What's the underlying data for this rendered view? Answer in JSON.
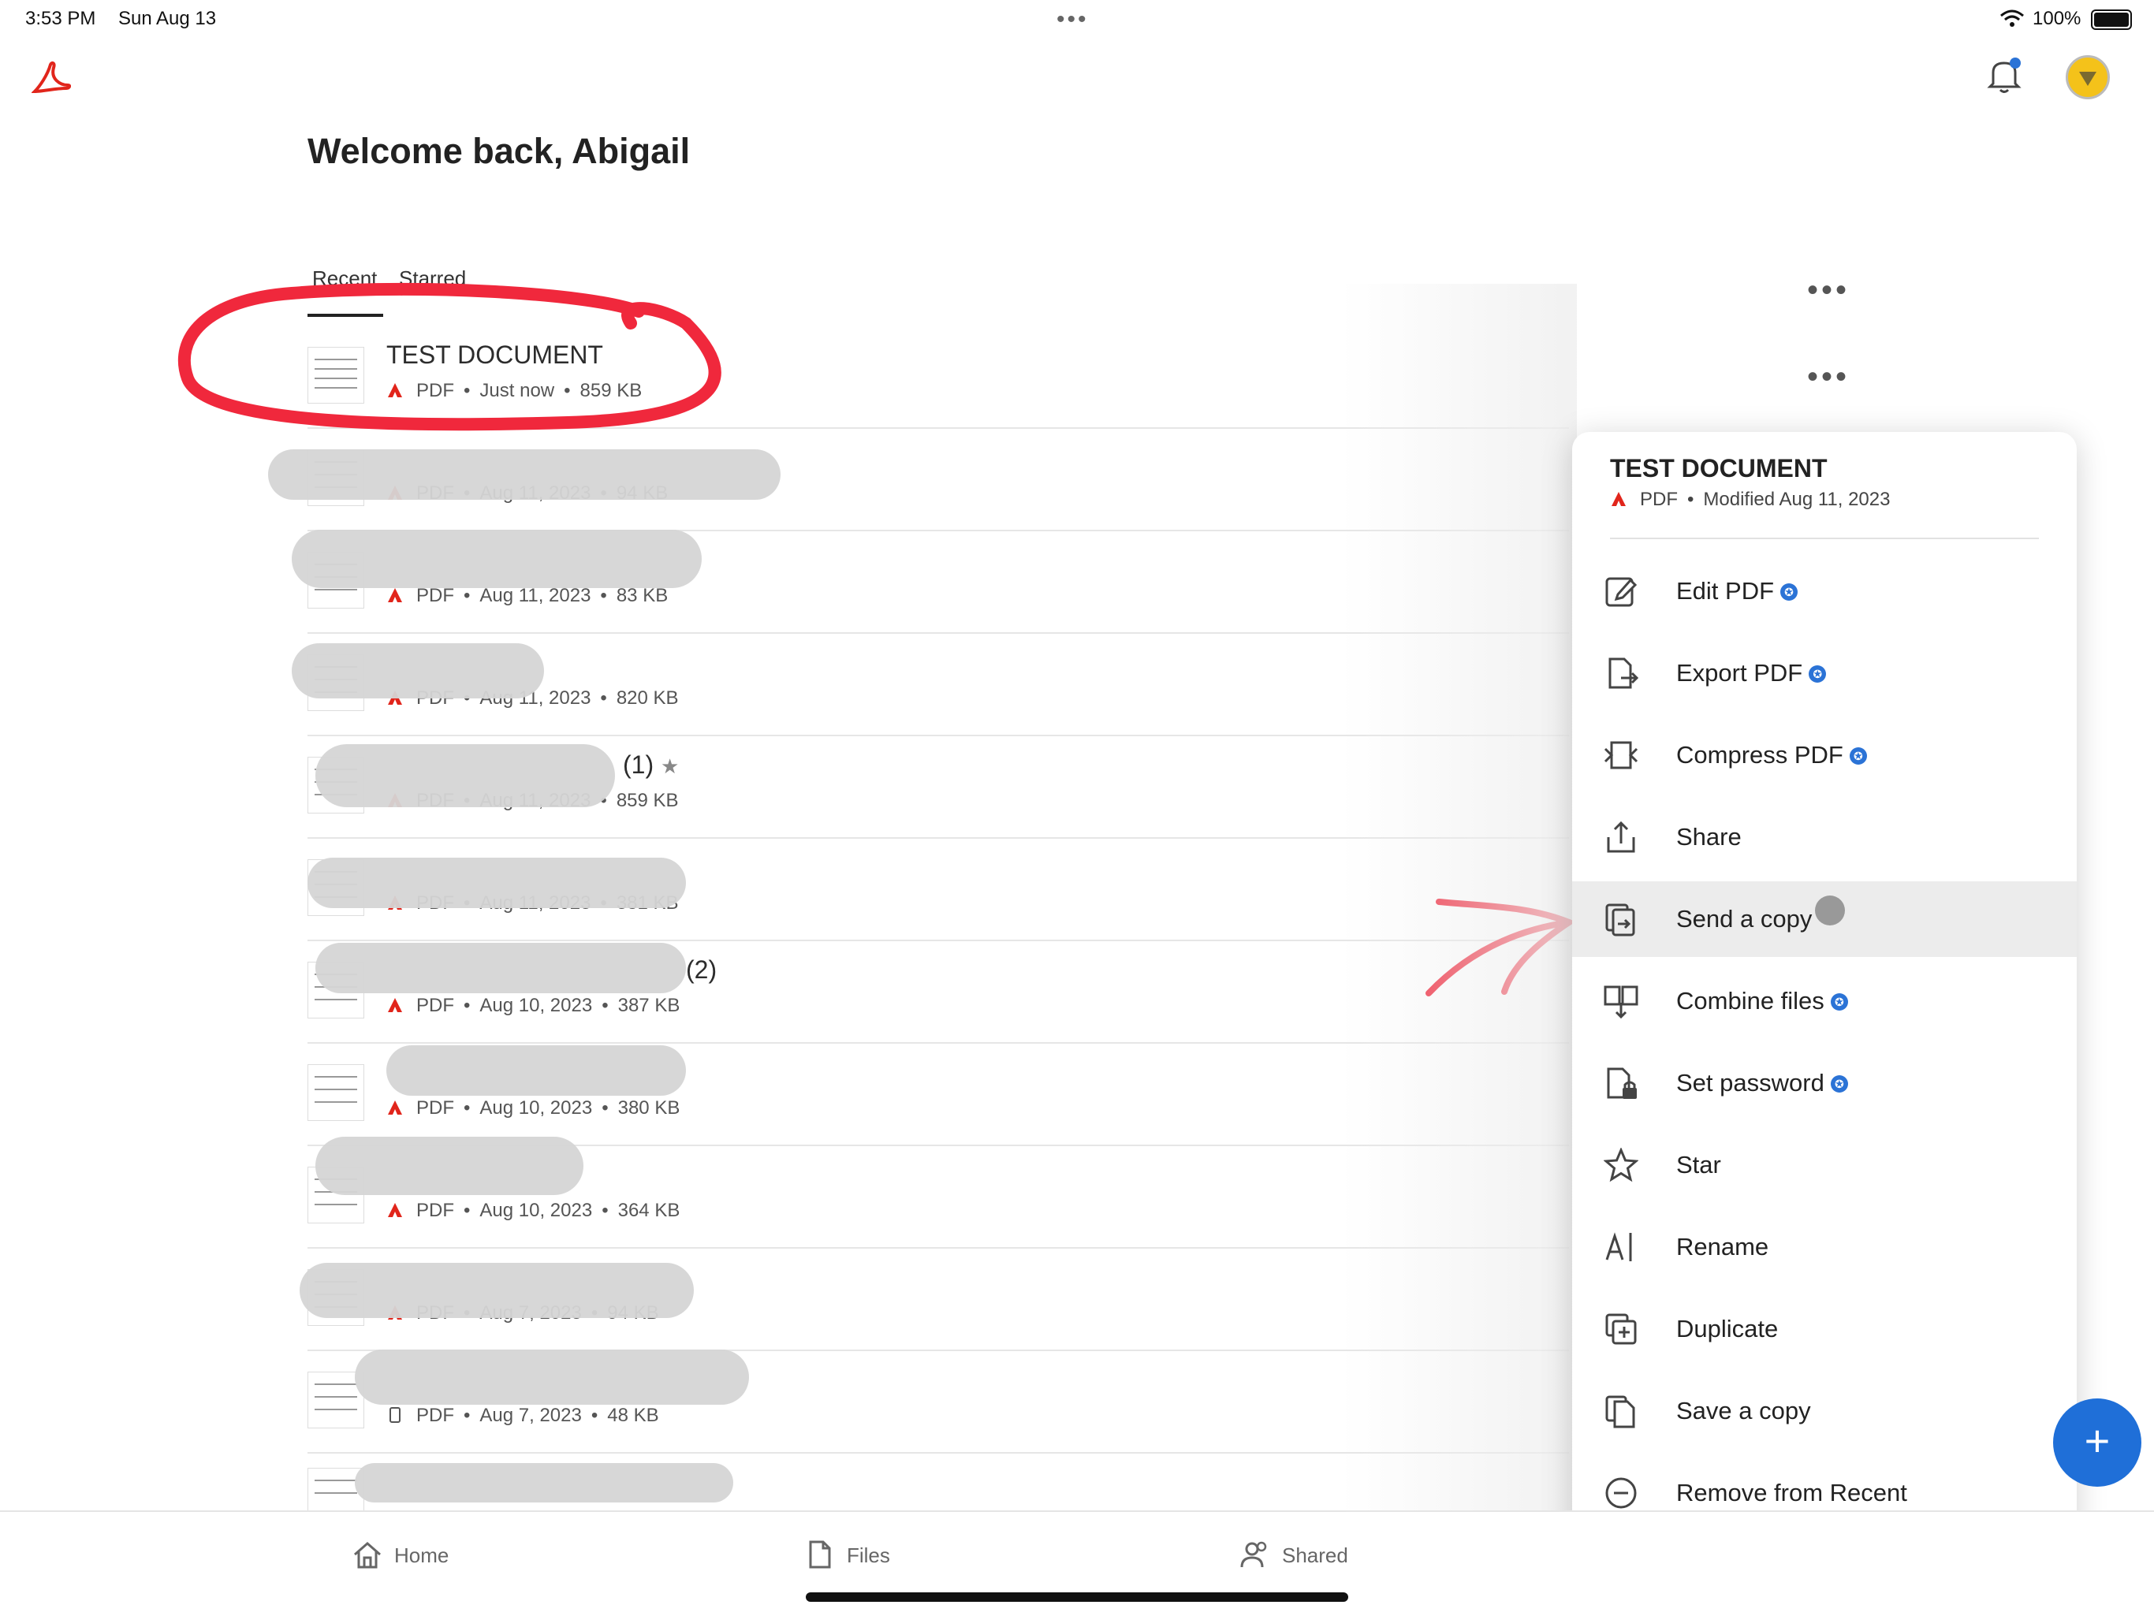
{
  "status_bar": {
    "time": "3:53 PM",
    "date": "Sun Aug 13",
    "battery": "100%"
  },
  "header": {
    "greeting": "Welcome back, Abigail"
  },
  "tabs": [
    {
      "label": "Recent"
    },
    {
      "label": "Starred"
    }
  ],
  "files": [
    {
      "name": "TEST DOCUMENT",
      "type": "PDF",
      "date": "Just now",
      "size": "859 KB"
    },
    {
      "name": "",
      "type": "PDF",
      "date": "Aug 11, 2023",
      "size": "94 KB"
    },
    {
      "name": "",
      "type": "PDF",
      "date": "Aug 11, 2023",
      "size": "83 KB"
    },
    {
      "name": "",
      "type": "PDF",
      "date": "Aug 11, 2023",
      "size": "820 KB"
    },
    {
      "name": "(1)",
      "type": "PDF",
      "date": "Aug 11, 2023",
      "size": "859 KB"
    },
    {
      "name": "",
      "type": "PDF",
      "date": "Aug 11, 2023",
      "size": "381 KB"
    },
    {
      "name": "(2)",
      "type": "PDF",
      "date": "Aug 10, 2023",
      "size": "387 KB"
    },
    {
      "name": "",
      "type": "PDF",
      "date": "Aug 10, 2023",
      "size": "380 KB"
    },
    {
      "name": "",
      "type": "PDF",
      "date": "Aug 10, 2023",
      "size": "364 KB"
    },
    {
      "name": "",
      "type": "PDF",
      "date": "Aug 7, 2023",
      "size": "94 KB"
    },
    {
      "name": "",
      "type": "PDF",
      "date": "Aug 7, 2023",
      "size": "48 KB"
    }
  ],
  "context_menu": {
    "file_name": "TEST DOCUMENT",
    "file_type": "PDF",
    "modified": "Modified Aug 11, 2023",
    "items": [
      {
        "label": "Edit PDF",
        "premium": true
      },
      {
        "label": "Export PDF",
        "premium": true
      },
      {
        "label": "Compress PDF",
        "premium": true
      },
      {
        "label": "Share",
        "premium": false
      },
      {
        "label": "Send a copy",
        "premium": false
      },
      {
        "label": "Combine files",
        "premium": true
      },
      {
        "label": "Set password",
        "premium": true
      },
      {
        "label": "Star",
        "premium": false
      },
      {
        "label": "Rename",
        "premium": false
      },
      {
        "label": "Duplicate",
        "premium": false
      },
      {
        "label": "Save a copy",
        "premium": false
      },
      {
        "label": "Remove from Recent",
        "premium": false
      }
    ]
  },
  "nav": {
    "home": "Home",
    "files": "Files",
    "shared": "Shared"
  },
  "fab": {
    "symbol": "+"
  },
  "colors": {
    "accent": "#1f6fd8",
    "adobe_red": "#e1251b",
    "annotation": "#f0283c"
  }
}
